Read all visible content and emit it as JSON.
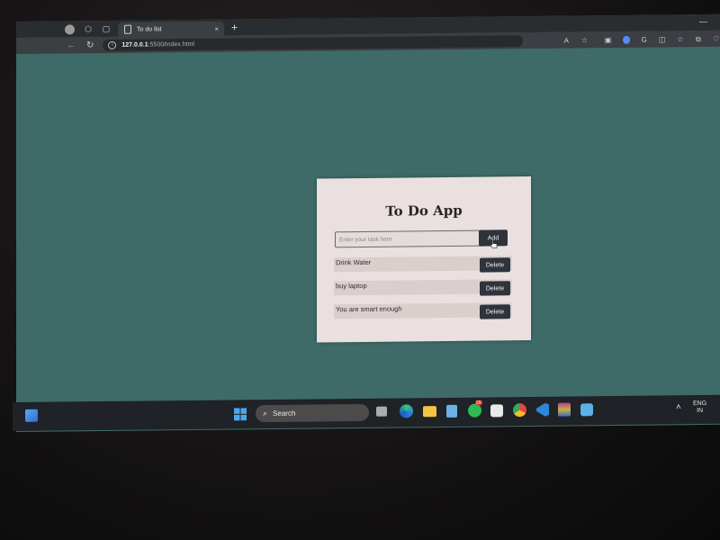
{
  "browser": {
    "tab_title": "To do list",
    "url_host": "127.0.0.1",
    "url_path": ":5500/index.html",
    "new_tab": "+",
    "close_tab": "×"
  },
  "app": {
    "title": "To Do App",
    "input_placeholder": "Enter your task here",
    "input_value": "",
    "add_label": "Add",
    "tasks": [
      {
        "text": "Drink Water",
        "delete_label": "Delete"
      },
      {
        "text": "buy laptop",
        "delete_label": "Delete"
      },
      {
        "text": "You are smart enough",
        "delete_label": "Delete"
      }
    ]
  },
  "taskbar": {
    "search_label": "Search",
    "whatsapp_badge": "20",
    "language_line1": "ENG",
    "language_line2": "IN"
  },
  "colors": {
    "page_bg": "#3e6b67",
    "card_bg": "#e9e0df",
    "button_bg": "#2f333c",
    "row_bg": "#d9cfcd"
  }
}
